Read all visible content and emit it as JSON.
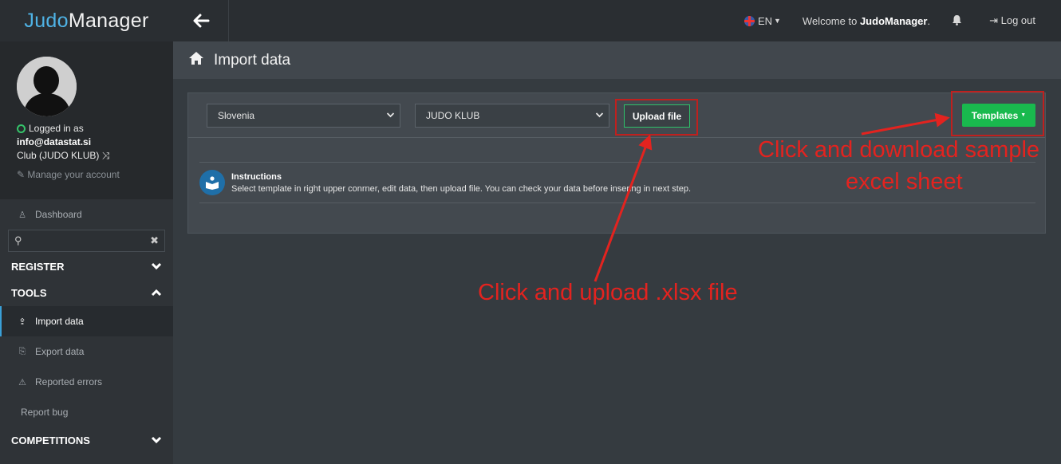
{
  "brand": {
    "part1": "Judo",
    "part2": "Manager"
  },
  "profile": {
    "logged_in_label": "Logged in as",
    "email": "info@datastat.si",
    "club": "Club (JUDO KLUB)",
    "manage_account": "Manage your account"
  },
  "sidebar": {
    "dashboard": "Dashboard",
    "search_placeholder": "",
    "register": "REGISTER",
    "tools": "TOOLS",
    "items": [
      {
        "label": "Import data"
      },
      {
        "label": "Export data"
      },
      {
        "label": "Reported errors"
      },
      {
        "label": "Report bug"
      }
    ],
    "competitions": "COMPETITIONS"
  },
  "topbar": {
    "lang": "EN",
    "welcome_prefix": "Welcome to",
    "welcome_brand": "JudoManager",
    "welcome_suffix": ".",
    "logout": "Log out"
  },
  "page": {
    "title": "Import data"
  },
  "panel": {
    "country_select": "Slovenia",
    "club_select": "JUDO KLUB",
    "upload_button": "Upload file",
    "templates_button": "Templates",
    "instructions_title": "Instructions",
    "instructions_text": "Select template in right upper conrner, edit data, then upload file. You can check your data before insering in next step."
  },
  "annotations": {
    "download_line1": "Click and download sample",
    "download_line2": "excel sheet",
    "upload": "Click and upload .xlsx file"
  },
  "colors": {
    "accent_blue": "#4fb3e6",
    "templates_green": "#19b94e",
    "annotation_red": "#e3231f",
    "logged_in_green": "#35c46a"
  }
}
